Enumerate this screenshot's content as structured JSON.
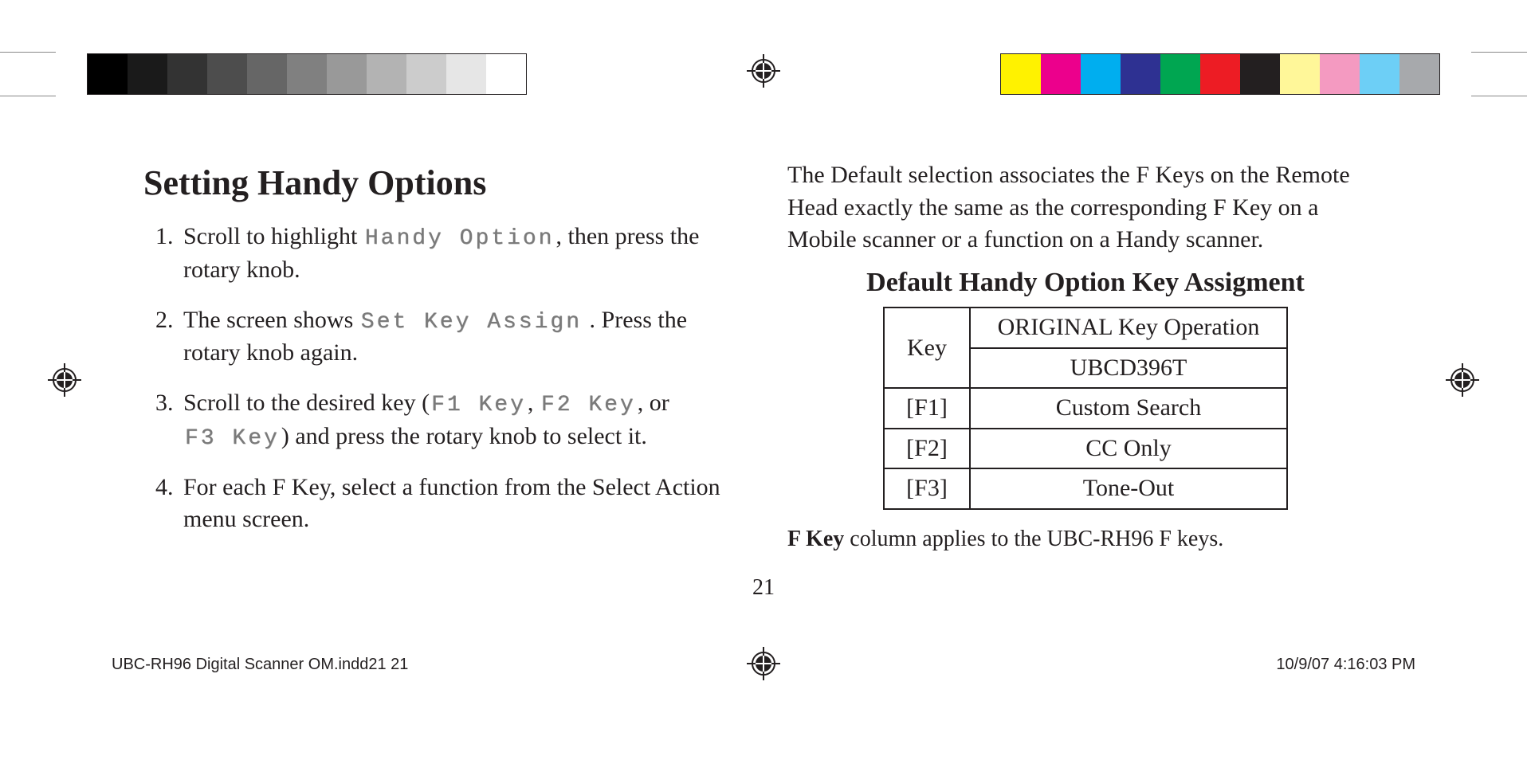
{
  "bars": {
    "grey": [
      "#000000",
      "#1a1a1a",
      "#333333",
      "#4d4d4d",
      "#666666",
      "#808080",
      "#999999",
      "#b3b3b3",
      "#cccccc",
      "#e6e6e6",
      "#ffffff"
    ],
    "color": [
      "#fff200",
      "#ec008c",
      "#00aeef",
      "#2e3192",
      "#00a651",
      "#ed1c24",
      "#231f20",
      "#fff799",
      "#f49ac1",
      "#6dcff6",
      "#a7a9ac"
    ]
  },
  "left": {
    "title": "Setting Handy Options",
    "steps": [
      {
        "pre": "Scroll to highlight ",
        "lcd": "Handy Option",
        "post": ", then press the rotary knob."
      },
      {
        "pre": "The screen shows ",
        "lcd": "Set Key Assign",
        "post": " . Press the rotary knob again."
      },
      {
        "pre": "Scroll to the desired key (",
        "lcd": "F1 Key",
        "mid1": ", ",
        "lcd2": "F2 Key",
        "mid2": ", or ",
        "lcd3": "F3 Key",
        "post": ") and press the rotary knob to select it."
      },
      {
        "pre": "For each F Key, select a function from the Select Action menu screen."
      }
    ]
  },
  "right": {
    "intro": "The Default selection associates the F Keys on the Remote Head exactly the same as the corresponding F Key on a Mobile scanner or a function on a Handy scanner.",
    "subtitle": "Default Handy Option Key Assigment",
    "table": {
      "headerKey": "Key",
      "headerOp1": "ORIGINAL Key Operation",
      "headerOp2": "UBCD396T",
      "rows": [
        {
          "key": "[F1]",
          "op": "Custom Search"
        },
        {
          "key": "[F2]",
          "op": "CC Only"
        },
        {
          "key": "[F3]",
          "op": "Tone-Out"
        }
      ]
    },
    "footnote_bold": "F Key",
    "footnote_rest": " column applies to the UBC-RH96 F keys."
  },
  "page_number": "21",
  "footer": {
    "left": "UBC-RH96 Digital Scanner OM.indd21   21",
    "right": "10/9/07   4:16:03 PM"
  }
}
